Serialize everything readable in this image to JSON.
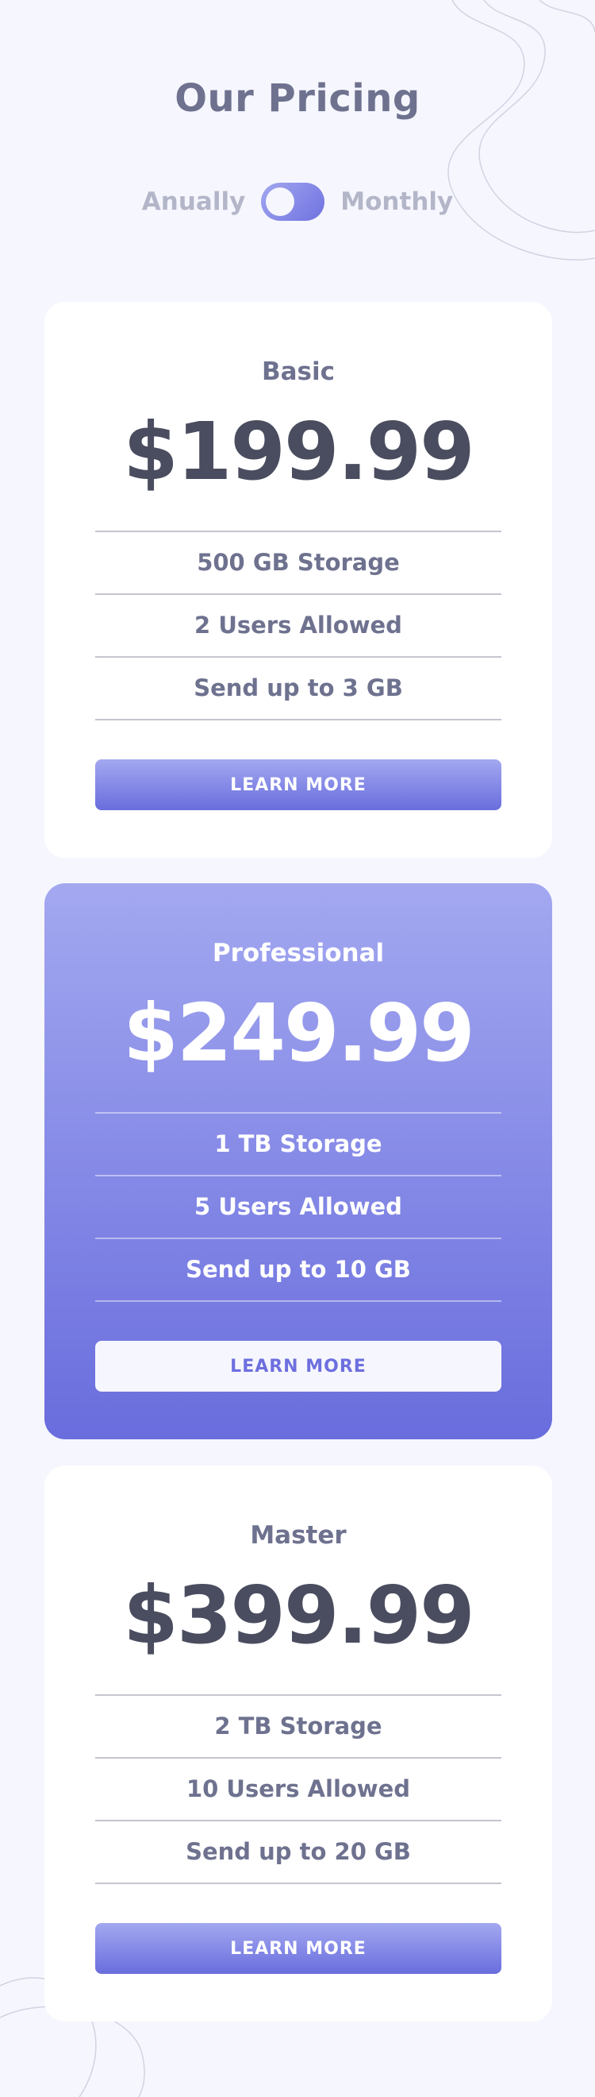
{
  "header": {
    "title": "Our Pricing",
    "toggle": {
      "left_label": "Anually",
      "right_label": "Monthly",
      "selected": "Anually"
    }
  },
  "plans": [
    {
      "name": "Basic",
      "price": "$199.99",
      "features": [
        "500 GB Storage",
        "2 Users Allowed",
        "Send up to 3 GB"
      ],
      "button_label": "LEARN MORE",
      "highlighted": false
    },
    {
      "name": "Professional",
      "price": "$249.99",
      "features": [
        "1 TB Storage",
        "5 Users Allowed",
        "Send up to 10 GB"
      ],
      "button_label": "LEARN MORE",
      "highlighted": true
    },
    {
      "name": "Master",
      "price": "$399.99",
      "features": [
        "2 TB Storage",
        "10 Users Allowed",
        "Send up to 20 GB"
      ],
      "button_label": "LEARN MORE",
      "highlighted": false
    }
  ],
  "colors": {
    "background": "#f6f6fe",
    "accent_light": "#a3a8f0",
    "accent_dark": "#696ddd",
    "heading": "#6e728f",
    "price": "#4a4d5f",
    "muted": "#b3b6c8"
  }
}
